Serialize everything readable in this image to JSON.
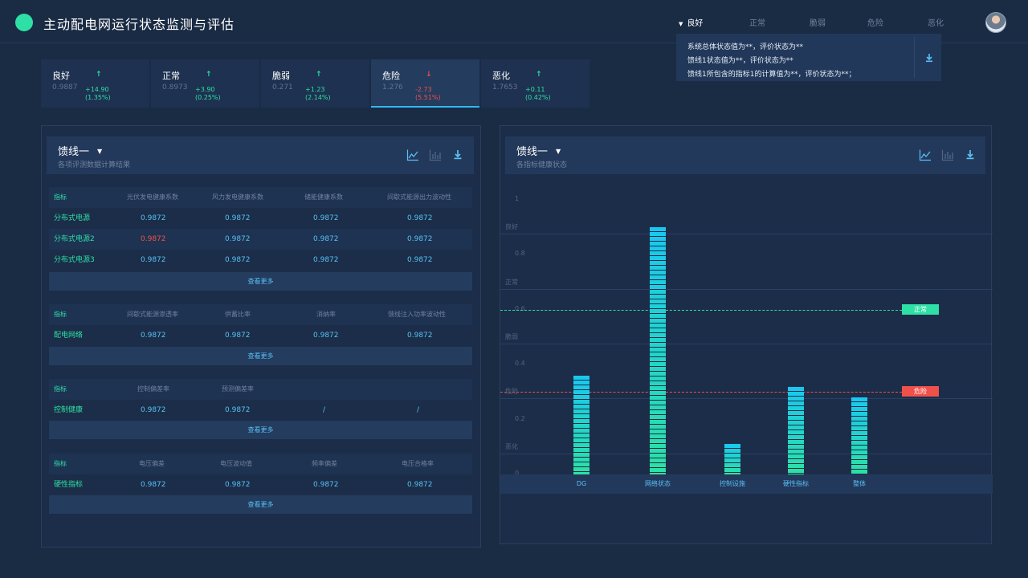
{
  "header": {
    "title": "主动配电网运行状态监测与评估",
    "status_tabs": [
      "良好",
      "正常",
      "脆弱",
      "危险",
      "恶化"
    ],
    "active_status": "良好"
  },
  "summary_popup": {
    "lines": [
      "系统总体状态值为**，评价状态为**",
      "馈线1状态值为**，评价状态为**",
      "馈线1所包含的指标1的计算值为**，评价状态为**；"
    ],
    "icon": "download-icon"
  },
  "stats": [
    {
      "label": "良好",
      "value": "0.9887",
      "direction": "up",
      "delta": "+14.90",
      "percent": "(1.35%)"
    },
    {
      "label": "正常",
      "value": "0.8973",
      "direction": "up",
      "delta": "+3.90",
      "percent": "(0.25%)"
    },
    {
      "label": "脆弱",
      "value": "0.271",
      "direction": "up",
      "delta": "+1.23",
      "percent": "(2.14%)"
    },
    {
      "label": "危险",
      "value": "1.276",
      "direction": "down",
      "delta": "-2.73",
      "percent": "(5.51%)"
    },
    {
      "label": "恶化",
      "value": "1.7653",
      "direction": "up",
      "delta": "+0.11",
      "percent": "(0.42%)"
    }
  ],
  "left_panel": {
    "title": "馈线一",
    "subtitle": "各项评测数据计算结果",
    "icons": [
      "line-chart-icon",
      "bar-chart-icon",
      "download-icon"
    ],
    "tables": [
      {
        "headers": [
          "指标",
          "光伏发电健康系数",
          "风力发电健康系数",
          "储能健康系数",
          "间歇式能源出力波动性"
        ],
        "rows": [
          [
            "分布式电源",
            "0.9872",
            "0.9872",
            "0.9872",
            "0.9872"
          ],
          [
            "分布式电源2",
            "0.9872",
            "0.9872",
            "0.9872",
            "0.9872"
          ],
          [
            "分布式电源3",
            "0.9872",
            "0.9872",
            "0.9872",
            "0.9872"
          ]
        ],
        "more": "查看更多"
      },
      {
        "headers": [
          "指标",
          "间歇式能源渗透率",
          "供蓄比率",
          "消纳率",
          "馈线注入功率波动性"
        ],
        "rows": [
          [
            "配电网络",
            "0.9872",
            "0.9872",
            "0.9872",
            "0.9872"
          ]
        ],
        "more": "查看更多"
      },
      {
        "headers": [
          "指标",
          "控制偏差率",
          "预测偏差率",
          "",
          ""
        ],
        "rows": [
          [
            "控制健康",
            "0.9872",
            "0.9872",
            "/",
            "/"
          ]
        ],
        "more": "查看更多"
      },
      {
        "headers": [
          "指标",
          "电压偏差",
          "电压波动值",
          "频率偏差",
          "电压合格率"
        ],
        "rows": [
          [
            "硬性指标",
            "0.9872",
            "0.9872",
            "0.9872",
            "0.9872"
          ]
        ],
        "more": "查看更多"
      }
    ],
    "highlight_color": "#f0504a"
  },
  "right_panel": {
    "title": "馈线一",
    "subtitle": "各指标健康状态",
    "icons": [
      "line-chart-icon",
      "bar-chart-icon",
      "download-icon"
    ]
  },
  "chart_data": {
    "type": "bar",
    "categories": [
      "DG",
      "网络状态",
      "控制设施",
      "硬性指标",
      "整体"
    ],
    "values": [
      0.36,
      0.9,
      0.11,
      0.32,
      0.28
    ],
    "ylim": [
      0,
      1
    ],
    "ytick_labels": [
      "1",
      "良好",
      "0.8",
      "正常",
      "0.6",
      "脆弱",
      "0.4",
      "危险",
      "0.2",
      "恶化",
      "0"
    ],
    "reference_lines": [
      {
        "label": "正常",
        "value": 0.6,
        "color": "#2ee0a6"
      },
      {
        "label": "危险",
        "value": 0.3,
        "color": "#f0504a"
      }
    ],
    "bar_gradient": [
      "#19c8f0",
      "#2de0a4"
    ]
  },
  "colors": {
    "background": "#1a2b44",
    "accent_green": "#2ee0a6",
    "accent_blue": "#58c0f5",
    "danger": "#f0504a"
  }
}
